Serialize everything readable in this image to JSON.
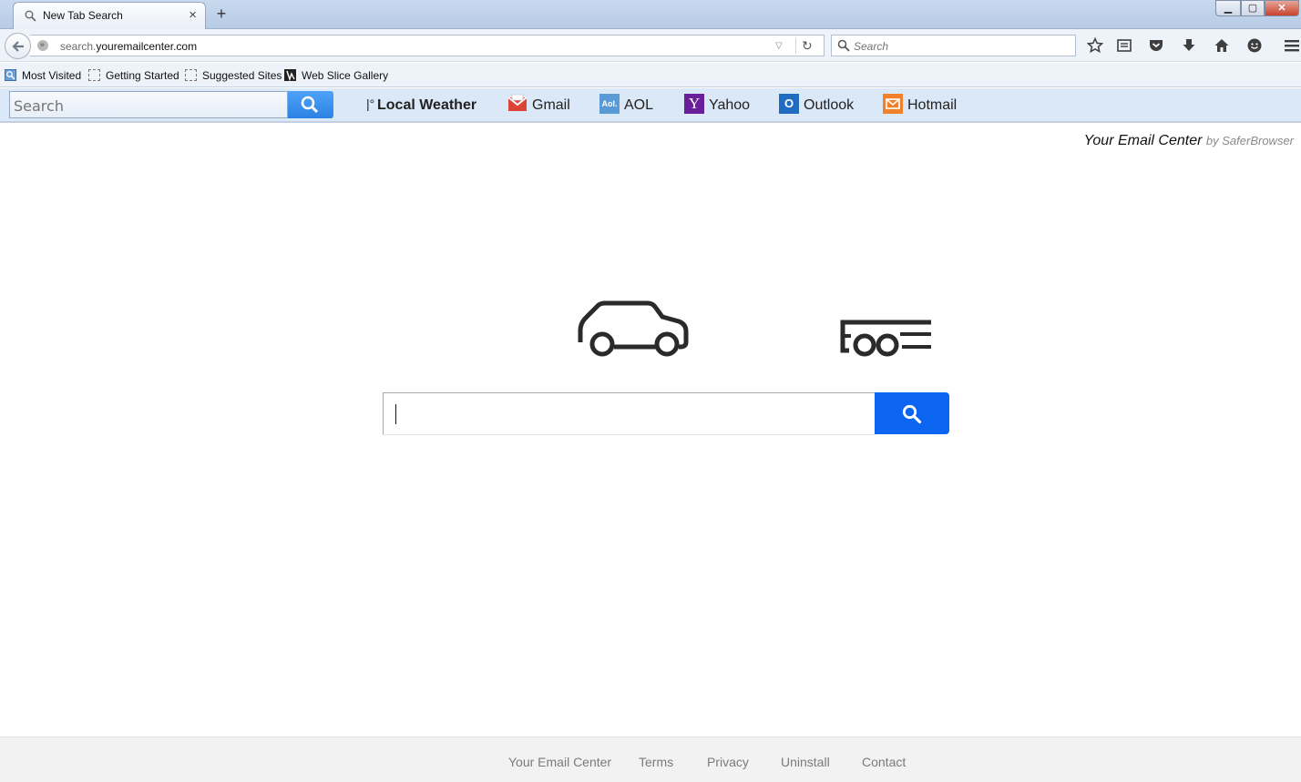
{
  "window": {
    "tab_title": "New Tab Search",
    "new_tab": "+",
    "tab_close": "×",
    "controls": {
      "minimize": "▁",
      "maximize": "▢",
      "close": "✕"
    }
  },
  "navbar": {
    "url_prefix": "search.",
    "url_domain": "youremailcenter.com",
    "search_placeholder": "Search",
    "toolbar_icons": [
      "star-icon",
      "reading-list-icon",
      "pocket-icon",
      "download-icon",
      "home-icon",
      "hello-icon",
      "menu-icon"
    ]
  },
  "bookmarks": {
    "items": [
      {
        "label": "Most Visited",
        "icon": "most-visited-icon"
      },
      {
        "label": "Getting Started",
        "icon": "page-icon"
      },
      {
        "label": "Suggested Sites",
        "icon": "page-icon"
      },
      {
        "label": "Web Slice Gallery",
        "icon": "web-slice-icon"
      }
    ]
  },
  "ext_toolbar": {
    "search_placeholder": "Search",
    "links": [
      {
        "label": "Local Weather",
        "icon": "weather-icon"
      },
      {
        "label": "Gmail",
        "icon": "gmail-icon",
        "color": "#db4437"
      },
      {
        "label": "AOL",
        "icon": "aol-icon",
        "icon_text": "Aol.",
        "color": "#5b9bd5"
      },
      {
        "label": "Yahoo",
        "icon": "yahoo-icon",
        "icon_text": "Y",
        "color": "#6a1f9a"
      },
      {
        "label": "Outlook",
        "icon": "outlook-icon",
        "icon_text": "O",
        "color": "#1f6cc1"
      },
      {
        "label": "Hotmail",
        "icon": "hotmail-icon",
        "color": "#f0802a"
      }
    ]
  },
  "brand": {
    "name": "Your Email Center",
    "by": "by SaferBrowser"
  },
  "main_search": {
    "value": "",
    "button_color": "#0b65f0"
  },
  "footer": {
    "links": [
      "Your Email Center",
      "Terms",
      "Privacy",
      "Uninstall",
      "Contact"
    ]
  }
}
